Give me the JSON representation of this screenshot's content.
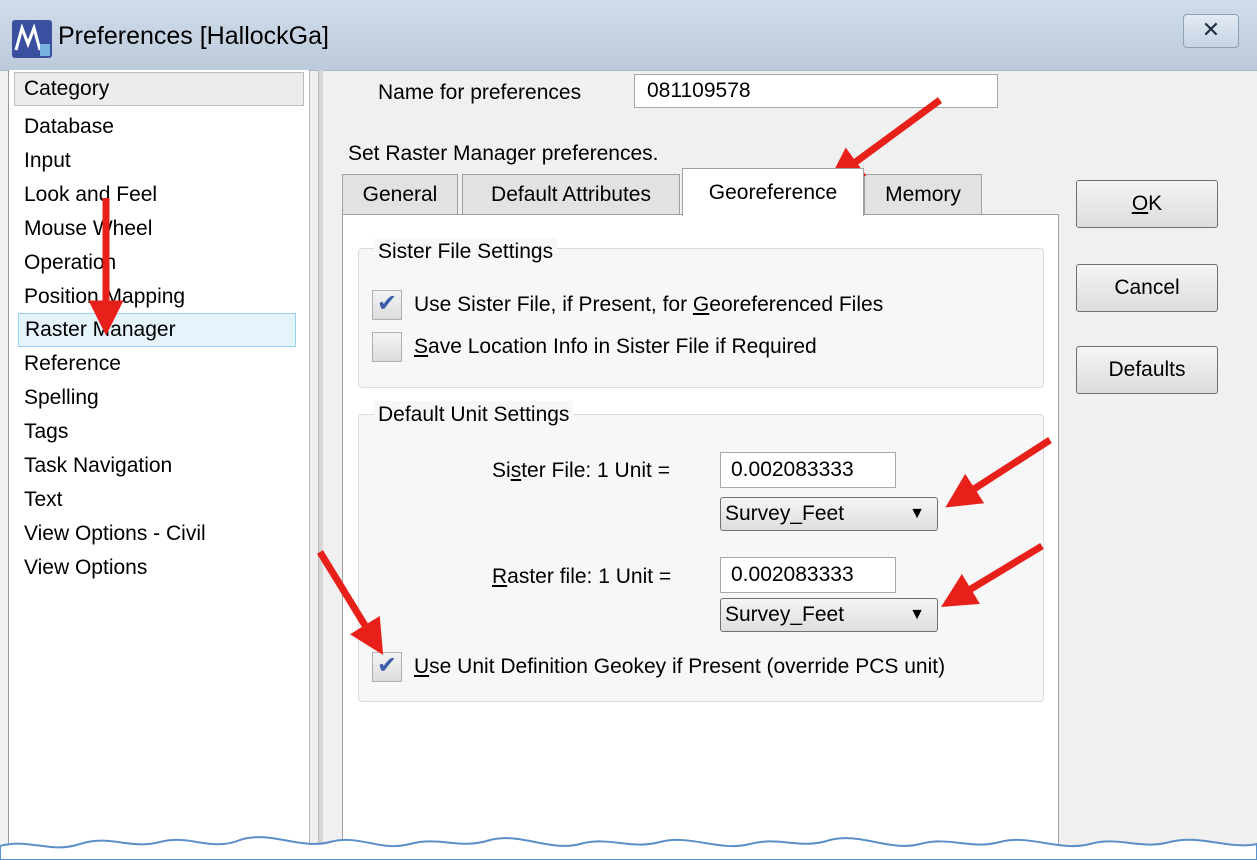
{
  "window": {
    "title": "Preferences [HallockGa]",
    "close_glyph": "✕"
  },
  "sidebar": {
    "header": "Category",
    "items": [
      {
        "label": "Database"
      },
      {
        "label": "Input"
      },
      {
        "label": "Look and Feel"
      },
      {
        "label": "Mouse Wheel"
      },
      {
        "label": "Operation"
      },
      {
        "label": "Position Mapping"
      },
      {
        "label": "Raster Manager",
        "selected": true
      },
      {
        "label": "Reference"
      },
      {
        "label": "Spelling"
      },
      {
        "label": "Tags"
      },
      {
        "label": "Task Navigation"
      },
      {
        "label": "Text"
      },
      {
        "label": "View Options - Civil"
      },
      {
        "label": "View Options"
      }
    ]
  },
  "name_field": {
    "label": "Name for preferences",
    "value": "081109578"
  },
  "description": "Set Raster Manager preferences.",
  "tabs": [
    {
      "label": "General"
    },
    {
      "label": "Default Attributes"
    },
    {
      "label": "Georeference",
      "active": true
    },
    {
      "label": "Memory"
    }
  ],
  "sister_group": {
    "title": "Sister File Settings",
    "use_sister": {
      "pre": "Use Sister File, if Present, for ",
      "mnemonic": "G",
      "post": "eoreferenced Files",
      "checked": true
    },
    "save_location": {
      "pre": "",
      "mnemonic": "S",
      "post": "ave Location Info in Sister File if Required",
      "checked": false
    }
  },
  "unit_group": {
    "title": "Default Unit Settings",
    "sister_unit": {
      "pre": "Si",
      "mnemonic": "s",
      "post": "ter File: 1 Unit =",
      "value": "0.002083333",
      "unit": "Survey_Feet"
    },
    "raster_unit": {
      "pre": "",
      "mnemonic": "R",
      "post": "aster file: 1 Unit =",
      "value": "0.002083333",
      "unit": "Survey_Feet"
    },
    "geokey": {
      "pre": "",
      "mnemonic": "U",
      "post": "se Unit Definition Geokey if Present (override PCS unit)",
      "checked": true
    }
  },
  "buttons": {
    "ok": {
      "mnemonic": "O",
      "post": "K"
    },
    "cancel": "Cancel",
    "defaults": "Defaults"
  },
  "icons": {
    "check": "✔",
    "dropdown": "▼"
  },
  "colors": {
    "annotation_arrow": "#e8201a",
    "title_bar": "#c6d4e4",
    "selection": "#e5f3fb",
    "check": "#3c5da8"
  }
}
